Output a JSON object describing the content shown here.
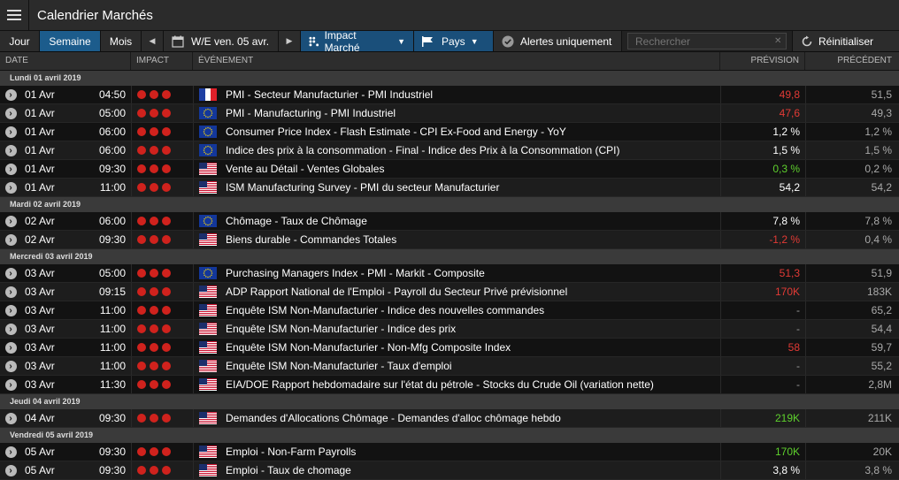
{
  "app": {
    "title": "Calendrier Marchés"
  },
  "toolbar": {
    "jour": "Jour",
    "semaine": "Semaine",
    "mois": "Mois",
    "prev_glyph": "◀",
    "next_glyph": "▶",
    "week_label": "W/E ven. 05 avr.",
    "impact": "Impact Marché",
    "pays": "Pays",
    "alertes": "Alertes uniquement",
    "search_placeholder": "Rechercher",
    "reset": "Réinitialiser"
  },
  "headers": {
    "date": "DATE",
    "impact": "IMPACT",
    "event": "ÉVÉNEMENT",
    "prevision": "PRÉVISION",
    "precedent": "PRÉCÉDENT"
  },
  "colors": {
    "accent": "#1c5c8c",
    "impact": "#d0221d",
    "negative": "#e23a35",
    "positive": "#5ed02d"
  },
  "groups": [
    {
      "label": "Lundi 01 avril 2019",
      "rows": [
        {
          "date": "01 Avr",
          "time": "04:50",
          "flag": "FR",
          "event": "PMI - Secteur Manufacturier - PMI Industriel",
          "prevision": "49,8",
          "pcolor": "red",
          "precedent": "51,5"
        },
        {
          "date": "01 Avr",
          "time": "05:00",
          "flag": "EU",
          "event": "PMI - Manufacturing - PMI Industriel",
          "prevision": "47,6",
          "pcolor": "red",
          "precedent": "49,3"
        },
        {
          "date": "01 Avr",
          "time": "06:00",
          "flag": "EU",
          "event": "Consumer Price Index - Flash Estimate - CPI Ex-Food and Energy - YoY",
          "prevision": "1,2 %",
          "pcolor": "white",
          "precedent": "1,2 %"
        },
        {
          "date": "01 Avr",
          "time": "06:00",
          "flag": "EU",
          "event": "Indice des prix à la consommation - Final - Indice des Prix à la Consommation (CPI)",
          "prevision": "1,5 %",
          "pcolor": "white",
          "precedent": "1,5 %"
        },
        {
          "date": "01 Avr",
          "time": "09:30",
          "flag": "US",
          "event": "Vente au Détail - Ventes Globales",
          "prevision": "0,3 %",
          "pcolor": "green",
          "precedent": "0,2 %"
        },
        {
          "date": "01 Avr",
          "time": "11:00",
          "flag": "US",
          "event": "ISM Manufacturing Survey - PMI du secteur Manufacturier",
          "prevision": "54,2",
          "pcolor": "white",
          "precedent": "54,2"
        }
      ]
    },
    {
      "label": "Mardi 02 avril 2019",
      "rows": [
        {
          "date": "02 Avr",
          "time": "06:00",
          "flag": "EU",
          "event": "Chômage - Taux de Chômage",
          "prevision": "7,8 %",
          "pcolor": "white",
          "precedent": "7,8 %"
        },
        {
          "date": "02 Avr",
          "time": "09:30",
          "flag": "US",
          "event": "Biens durable - Commandes Totales",
          "prevision": "-1,2 %",
          "pcolor": "red",
          "precedent": "0,4 %"
        }
      ]
    },
    {
      "label": "Mercredi 03 avril 2019",
      "rows": [
        {
          "date": "03 Avr",
          "time": "05:00",
          "flag": "EU",
          "event": "Purchasing Managers Index - PMI - Markit - Composite",
          "prevision": "51,3",
          "pcolor": "red",
          "precedent": "51,9"
        },
        {
          "date": "03 Avr",
          "time": "09:15",
          "flag": "US",
          "event": "ADP Rapport National de l'Emploi - Payroll du Secteur Privé prévisionnel",
          "prevision": "170K",
          "pcolor": "red",
          "precedent": "183K"
        },
        {
          "date": "03 Avr",
          "time": "11:00",
          "flag": "US",
          "event": "Enquête ISM Non-Manufacturier - Indice des nouvelles commandes",
          "prevision": "-",
          "pcolor": "dash",
          "precedent": "65,2"
        },
        {
          "date": "03 Avr",
          "time": "11:00",
          "flag": "US",
          "event": "Enquête ISM Non-Manufacturier - Indice des prix",
          "prevision": "-",
          "pcolor": "dash",
          "precedent": "54,4"
        },
        {
          "date": "03 Avr",
          "time": "11:00",
          "flag": "US",
          "event": "Enquête ISM Non-Manufacturier - Non-Mfg Composite Index",
          "prevision": "58",
          "pcolor": "red",
          "precedent": "59,7"
        },
        {
          "date": "03 Avr",
          "time": "11:00",
          "flag": "US",
          "event": "Enquête ISM Non-Manufacturier - Taux d'emploi",
          "prevision": "-",
          "pcolor": "dash",
          "precedent": "55,2"
        },
        {
          "date": "03 Avr",
          "time": "11:30",
          "flag": "US",
          "event": "EIA/DOE Rapport hebdomadaire sur l'état du pétrole - Stocks du Crude Oil (variation nette)",
          "prevision": "-",
          "pcolor": "dash",
          "precedent": "2,8M"
        }
      ]
    },
    {
      "label": "Jeudi 04 avril 2019",
      "rows": [
        {
          "date": "04 Avr",
          "time": "09:30",
          "flag": "US",
          "event": "Demandes d'Allocations Chômage - Demandes d'alloc chômage hebdo",
          "prevision": "219K",
          "pcolor": "green",
          "precedent": "211K"
        }
      ]
    },
    {
      "label": "Vendredi 05 avril 2019",
      "rows": [
        {
          "date": "05 Avr",
          "time": "09:30",
          "flag": "US",
          "event": "Emploi - Non-Farm Payrolls",
          "prevision": "170K",
          "pcolor": "green",
          "precedent": "20K"
        },
        {
          "date": "05 Avr",
          "time": "09:30",
          "flag": "US",
          "event": "Emploi - Taux de chomage",
          "prevision": "3,8 %",
          "pcolor": "white",
          "precedent": "3,8 %"
        }
      ]
    }
  ]
}
